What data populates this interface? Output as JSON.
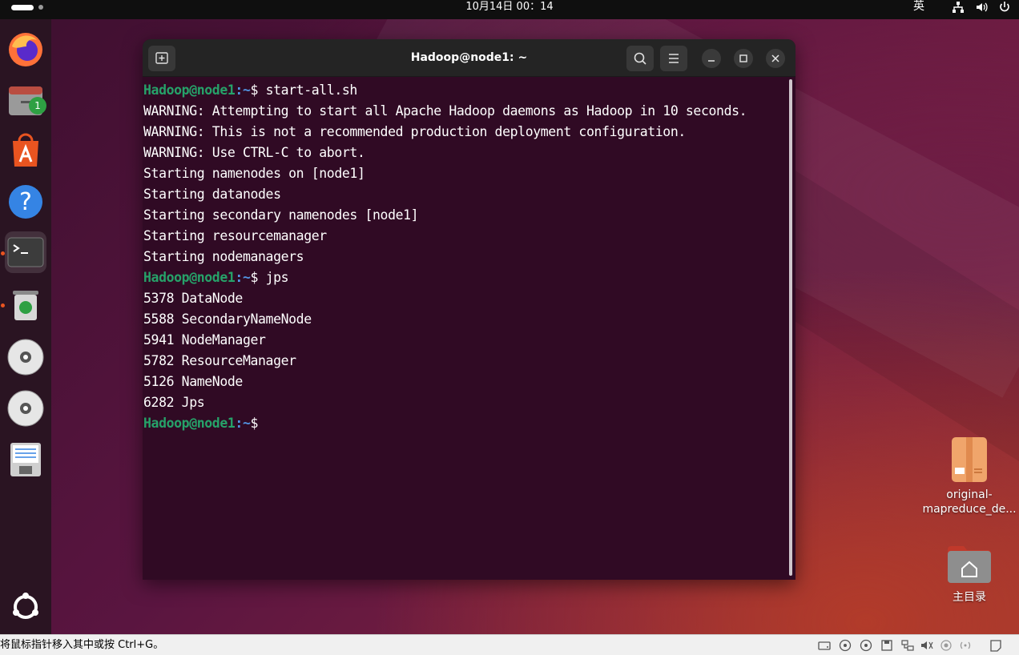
{
  "topbar": {
    "clock": "10月14日  00：14",
    "input_method": "英"
  },
  "dock": {
    "items": [
      {
        "name": "firefox",
        "icon": "firefox-icon"
      },
      {
        "name": "files",
        "icon": "file-cabinet-icon",
        "badge": "1"
      },
      {
        "name": "app-center",
        "icon": "app-center-icon"
      },
      {
        "name": "help",
        "icon": "help-icon"
      },
      {
        "name": "terminal",
        "icon": "terminal-icon"
      },
      {
        "name": "trash",
        "icon": "trash-icon"
      },
      {
        "name": "disc-1",
        "icon": "cd-icon"
      },
      {
        "name": "disc-2",
        "icon": "cd-icon"
      },
      {
        "name": "text-editor",
        "icon": "floppy-doc-icon"
      },
      {
        "name": "show-apps",
        "icon": "ubuntu-logo-icon"
      }
    ]
  },
  "terminal": {
    "title": "Hadoop@node1: ~",
    "prompt_user": "Hadoop@node1",
    "prompt_path": ":~",
    "prompt_symbol": "$",
    "cmd1": " start-all.sh",
    "lines1": [
      "WARNING: Attempting to start all Apache Hadoop daemons as Hadoop in 10 seconds.",
      "WARNING: This is not a recommended production deployment configuration.",
      "WARNING: Use CTRL-C to abort.",
      "Starting namenodes on [node1]",
      "Starting datanodes",
      "Starting secondary namenodes [node1]",
      "Starting resourcemanager",
      "Starting nodemanagers"
    ],
    "cmd2": " jps",
    "lines2": [
      "5378 DataNode",
      "5588 SecondaryNameNode",
      "5941 NodeManager",
      "5782 ResourceManager",
      "5126 NameNode",
      "6282 Jps"
    ]
  },
  "desktop": {
    "file_label_1": "original-",
    "file_label_2": "mapreduce_de...",
    "home_label": "主目录"
  },
  "statusbar": {
    "text": "将鼠标指针移入其中或按 Ctrl+G。"
  },
  "colors": {
    "terminal_bg": "#300a24",
    "prompt_user": "#26a269",
    "prompt_path": "#5294e2",
    "accent": "#e95420"
  }
}
